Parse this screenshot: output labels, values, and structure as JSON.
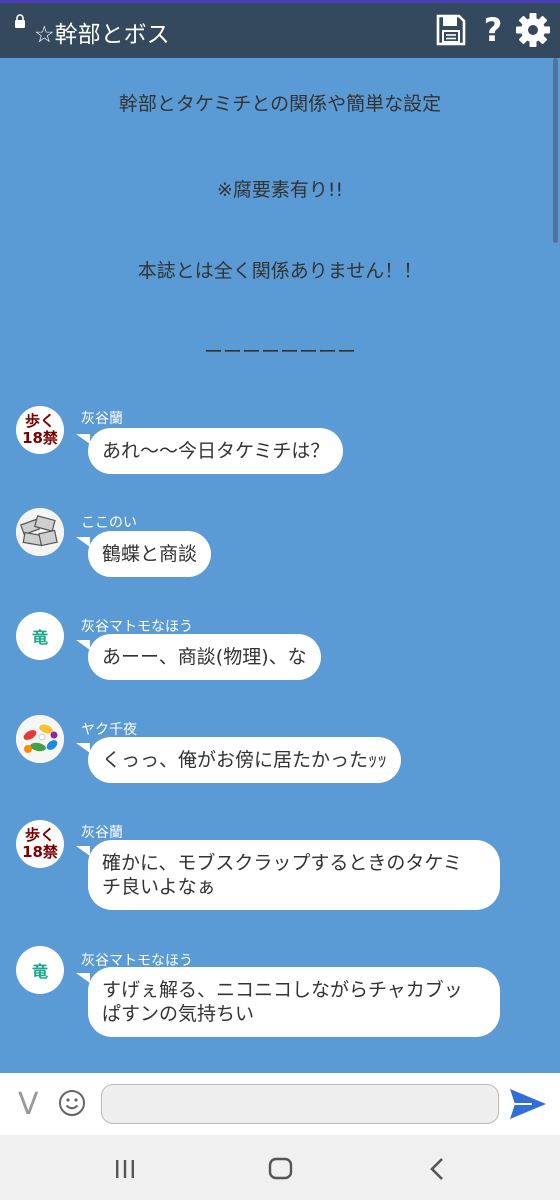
{
  "header": {
    "title": "☆幹部とボス",
    "icons": [
      "lock-icon",
      "save-icon",
      "help-icon",
      "gear-icon"
    ],
    "help_label": "?"
  },
  "intro": [
    "幹部とタケミチとの関係や簡単な設定",
    "※腐要素有り!!",
    "本誌とは全く関係ありません！！",
    "ーーーーーーーー"
  ],
  "messages": [
    {
      "sender": "灰谷蘭",
      "avatar": {
        "type": "text",
        "line1": "歩く",
        "line2": "18禁"
      },
      "lines": [
        "あれ〜〜今日タケミチは？"
      ]
    },
    {
      "sender": "ここのい",
      "avatar": {
        "type": "image"
      },
      "lines": [
        "鶴蝶と商談"
      ]
    },
    {
      "sender": "灰谷マトモなほう",
      "avatar": {
        "type": "ryu",
        "char": "竜"
      },
      "lines": [
        "あーー、商談(物理)、な"
      ]
    },
    {
      "sender": "ヤク千夜",
      "avatar": {
        "type": "pills"
      },
      "lines": [
        "くっっ、俺がお傍に居たかったｯｯ"
      ]
    },
    {
      "sender": "灰谷蘭",
      "avatar": {
        "type": "text",
        "line1": "歩く",
        "line2": "18禁"
      },
      "lines": [
        "確かに、モブスクラップするときのタケミ",
        "チ良いよなぁ"
      ]
    },
    {
      "sender": "灰谷マトモなほう",
      "avatar": {
        "type": "ryu",
        "char": "竜"
      },
      "lines": [
        "すげぇ解る、ニコニコしながらチャカブッ",
        "ぱすンの気持ちい"
      ]
    }
  ],
  "input": {
    "v_label": "V",
    "placeholder": "",
    "icons": [
      "v-icon",
      "smile-icon",
      "send-icon"
    ]
  },
  "colors": {
    "background": "#5b9bd5",
    "header": "#35495e",
    "send": "#2f6fd6"
  }
}
